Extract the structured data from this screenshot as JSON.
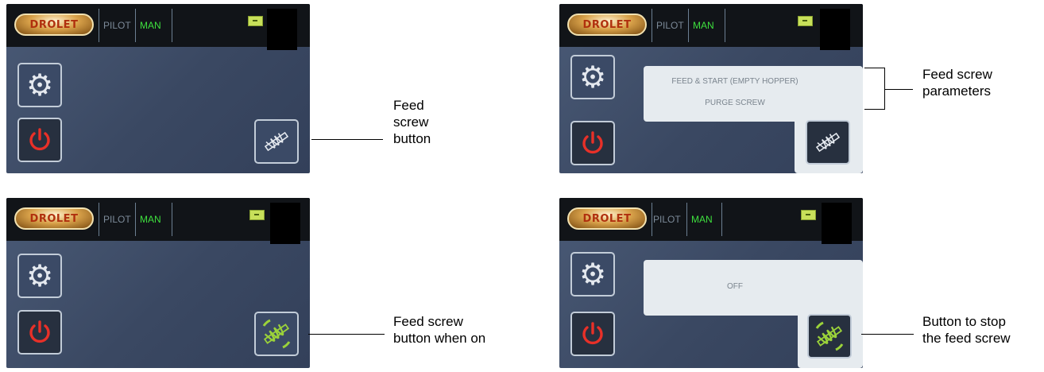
{
  "common": {
    "logo_text": "DROLET",
    "mode_pilot": "PILOT",
    "mode_man": "MAN"
  },
  "screens": [
    {
      "feed_state": "off"
    },
    {
      "feed_state": "off",
      "info_lines": [
        "FEED & START (EMPTY HOPPER)",
        "PURGE SCREW"
      ]
    },
    {
      "feed_state": "on"
    },
    {
      "feed_state": "on",
      "info_lines": [
        "OFF"
      ]
    }
  ],
  "callouts": {
    "feed_button": [
      "Feed",
      "screw",
      "button"
    ],
    "feed_params": [
      "Feed screw",
      "parameters"
    ],
    "feed_on": [
      "Feed screw",
      "button when on"
    ],
    "stop_feed": [
      "Button to stop",
      "the feed screw"
    ]
  },
  "colors": {
    "accent_green": "#3ee03e",
    "power_red": "#e83028",
    "feed_on_green": "#9bd23a"
  },
  "icons": [
    "gear-icon",
    "power-icon",
    "feed-screw-icon",
    "battery-icon"
  ]
}
